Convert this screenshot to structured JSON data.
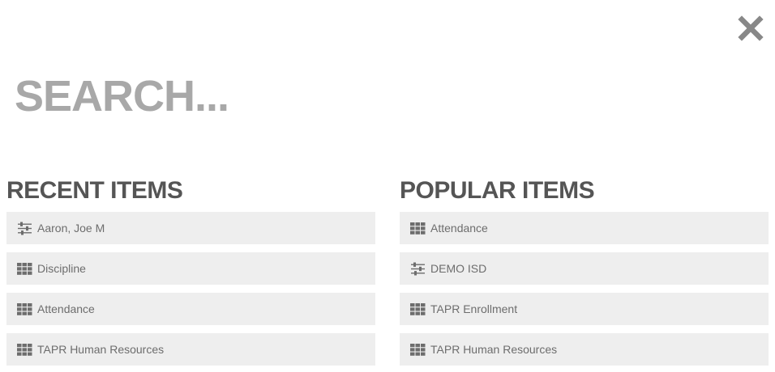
{
  "search": {
    "placeholder": "SEARCH...",
    "value": ""
  },
  "recent": {
    "heading": "RECENT ITEMS",
    "items": [
      {
        "label": "Aaron, Joe M",
        "icon": "sliders-icon"
      },
      {
        "label": "Discipline",
        "icon": "grid-icon"
      },
      {
        "label": "Attendance",
        "icon": "grid-icon"
      },
      {
        "label": "TAPR Human Resources",
        "icon": "grid-icon"
      }
    ]
  },
  "popular": {
    "heading": "POPULAR ITEMS",
    "items": [
      {
        "label": "Attendance",
        "icon": "grid-icon"
      },
      {
        "label": "DEMO ISD",
        "icon": "sliders-icon"
      },
      {
        "label": "TAPR Enrollment",
        "icon": "grid-icon"
      },
      {
        "label": "TAPR Human Resources",
        "icon": "grid-icon"
      }
    ]
  },
  "close": {
    "icon": "close-icon"
  },
  "colors": {
    "heading": "#555555",
    "search_text": "#a8a8a8",
    "item_bg": "#eeeeee",
    "item_text": "#6d6d6d",
    "icon": "#6d6d6d",
    "close_icon": "#888888"
  }
}
